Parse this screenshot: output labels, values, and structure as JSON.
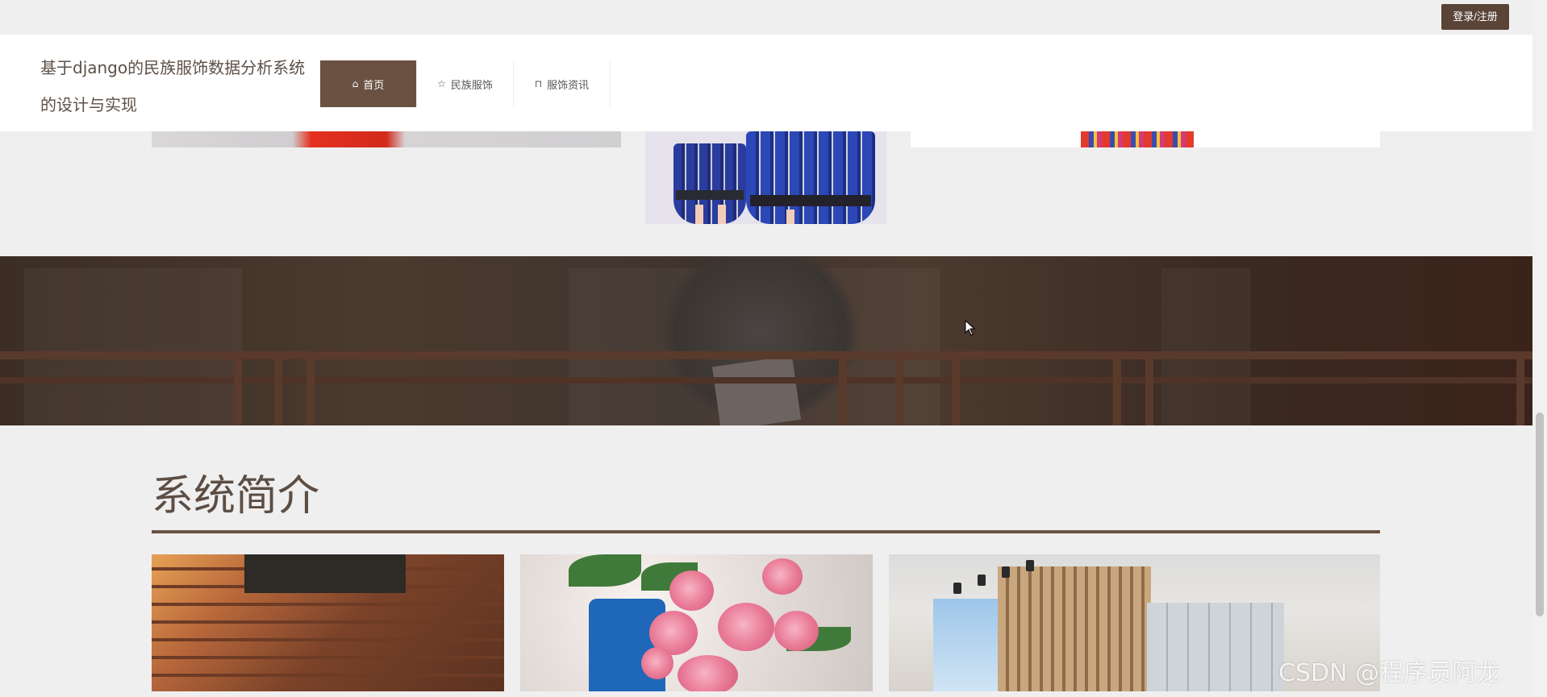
{
  "topbar": {
    "login_label": "登录/注册"
  },
  "header": {
    "site_title": "基于django的民族服饰数据分析系统的设计与实现",
    "nav": [
      {
        "label": "首页",
        "icon": "home-icon",
        "active": true
      },
      {
        "label": "民族服饰",
        "icon": "star-icon",
        "active": false
      },
      {
        "label": "服饰资讯",
        "icon": "bag-icon",
        "active": false
      }
    ]
  },
  "intro": {
    "title": "系统简介"
  },
  "watermark": "CSDN @程序员阿龙",
  "colors": {
    "accent": "#6a5142",
    "login_bg": "#5a4438",
    "title_text": "#5c4e44"
  }
}
